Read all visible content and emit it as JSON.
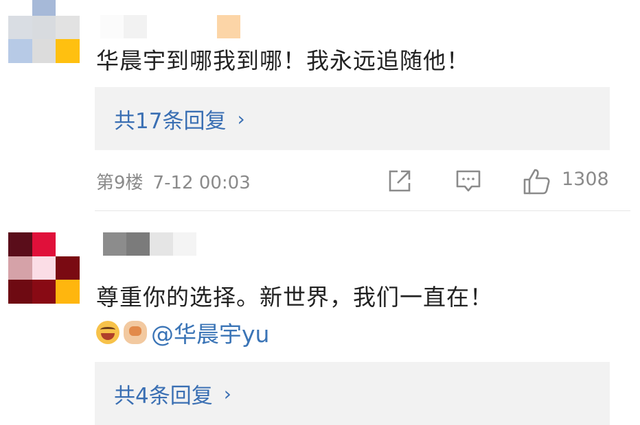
{
  "comments": [
    {
      "text": "华晨宇到哪我到哪！我永远追随他！",
      "replies_label": "共17条回复",
      "chevron": "›",
      "floor": "第9楼",
      "time": "7-12 00:03",
      "likes": "1308",
      "avatar_colors": [
        "#ffffff",
        "#a6b9d8",
        "#ffffff",
        "#d9dde3",
        "#d8dbdf",
        "#e2e2e2",
        "#b7cae6",
        "#dcdcdc",
        "#ffc010"
      ],
      "name_colors": [
        "#fbfbfb",
        "#f2f2f2",
        "#ffffff",
        "#ffffff",
        "#ffffff",
        "#fcd5a7"
      ]
    },
    {
      "text": "尊重你的选择。新世界，我们一直在！",
      "emojis": [
        "laugh-cry-emoji",
        "fist-emoji"
      ],
      "mention": "@华晨宇yu",
      "replies_label": "共4条回复",
      "chevron": "›",
      "avatar_colors": [
        "#5a0d1a",
        "#e0103a",
        "#ffffff",
        "#d5a2a8",
        "#fbdde6",
        "#7a0a12",
        "#6e0a12",
        "#880a14",
        "#ffb60e"
      ],
      "name_colors": [
        "#8c8c8c",
        "#7b7b7b",
        "#e5e5e5",
        "#f4f4f4"
      ]
    }
  ],
  "colors": {
    "link": "#3a6fb3",
    "text": "#222222",
    "meta": "#8a8a8a",
    "reply_bg": "#f2f2f2"
  }
}
